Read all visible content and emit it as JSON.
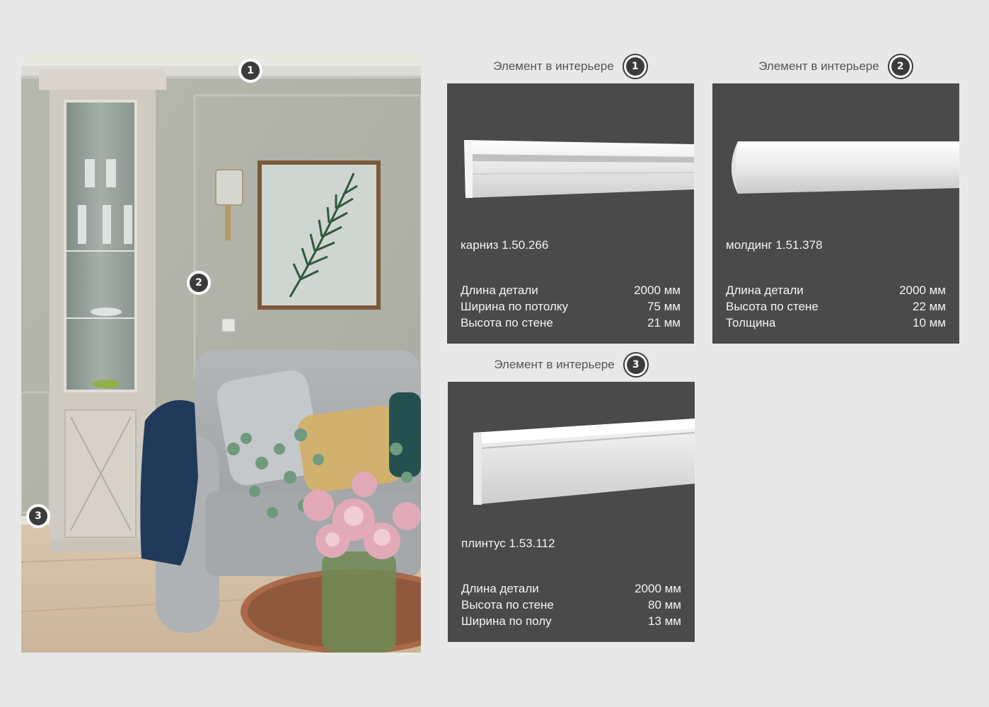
{
  "photo": {
    "markers": [
      "1",
      "2",
      "3"
    ]
  },
  "cards": [
    {
      "heading": "Элемент в интерьере",
      "number": "1",
      "name": "карниз 1.50.266",
      "specs": [
        {
          "label": "Длина детали",
          "value": "2000 мм"
        },
        {
          "label": "Ширина по потолку",
          "value": "75 мм"
        },
        {
          "label": "Высота по стене",
          "value": "21 мм"
        }
      ]
    },
    {
      "heading": "Элемент в интерьере",
      "number": "2",
      "name": "молдинг 1.51.378",
      "specs": [
        {
          "label": "Длина детали",
          "value": "2000 мм"
        },
        {
          "label": "Высота по стене",
          "value": "22 мм"
        },
        {
          "label": "Толщина",
          "value": "10 мм"
        }
      ]
    },
    {
      "heading": "Элемент в интерьере",
      "number": "3",
      "name": "плинтус 1.53.112",
      "specs": [
        {
          "label": "Длина детали",
          "value": "2000 мм"
        },
        {
          "label": "Высота по стене",
          "value": "80 мм"
        },
        {
          "label": "Ширина по полу",
          "value": "13 мм"
        }
      ]
    }
  ],
  "colors": {
    "page_bg": "#e8e8e8",
    "card_bg": "#4a4a4a",
    "accent_dark": "#3b3b3b"
  }
}
